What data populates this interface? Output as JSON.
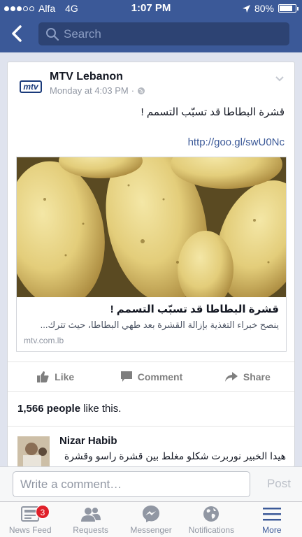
{
  "status_bar": {
    "carrier": "Alfa",
    "network": "4G",
    "time": "1:07 PM",
    "battery": "80%",
    "battery_level": 0.8
  },
  "header": {
    "search_placeholder": "Search"
  },
  "post": {
    "author": "MTV Lebanon",
    "avatar_text": "mtv",
    "timestamp": "Monday at 4:03 PM",
    "separator": "·",
    "text": "قشرة البطاطا قد تسبّب التسمم !",
    "link": "http://goo.gl/swU0Nc",
    "preview": {
      "title": "قشرة البطاطا قد تسبّب التسمم !",
      "description": "ينصح خبراء التغذية بإزالة القشرة بعد طهي البطاطا، حيث تترك...",
      "domain": "mtv.com.lb"
    },
    "actions": {
      "like": "Like",
      "comment": "Comment",
      "share": "Share"
    },
    "likes": {
      "count": "1,566 people",
      "suffix": " like this."
    },
    "comment": {
      "name": "Nizar Habib",
      "text": "هيدا الخبير نوربرت شكلو مغلط بين قشرة راسو وقشرة"
    }
  },
  "comment_bar": {
    "placeholder": "Write a comment…",
    "post_label": "Post"
  },
  "tabs": [
    {
      "label": "News Feed",
      "icon": "news-feed-icon",
      "badge": "3"
    },
    {
      "label": "Requests",
      "icon": "friends-icon"
    },
    {
      "label": "Messenger",
      "icon": "messenger-icon"
    },
    {
      "label": "Notifications",
      "icon": "globe-icon"
    },
    {
      "label": "More",
      "icon": "menu-icon",
      "active": true
    }
  ],
  "colors": {
    "brand": "#3b5998",
    "badge": "#e0202a"
  }
}
